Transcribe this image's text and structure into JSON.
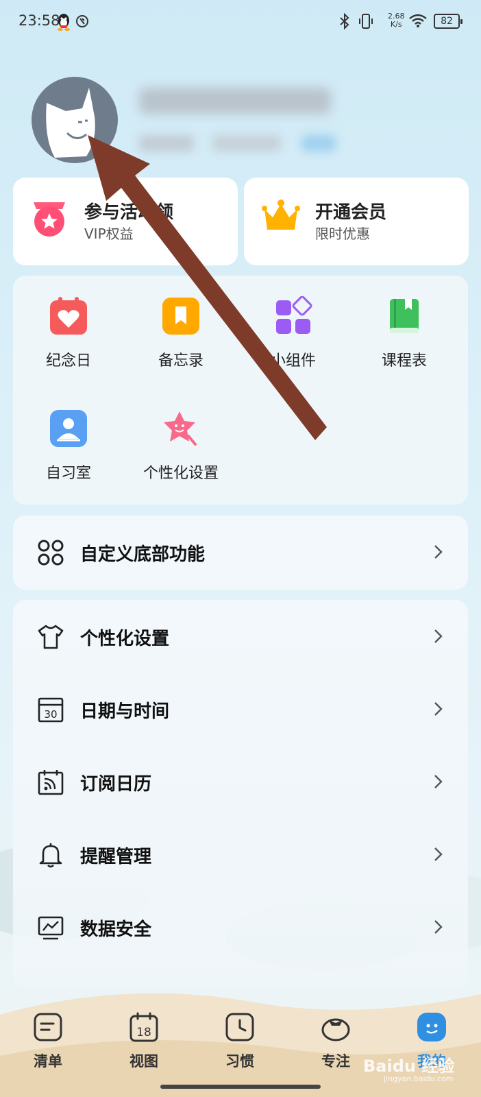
{
  "status_bar": {
    "time": "23:58",
    "net_speed_value": "2.68",
    "net_speed_unit": "K/s",
    "battery": "82"
  },
  "promo": {
    "activity": {
      "title": "参与活动领",
      "subtitle": "VIP权益",
      "icon": "medal-star-icon"
    },
    "membership": {
      "title": "开通会员",
      "subtitle": "限时优惠",
      "icon": "crown-icon"
    }
  },
  "tools": [
    {
      "label": "纪念日",
      "icon": "anniversary-heart-icon"
    },
    {
      "label": "备忘录",
      "icon": "memo-bookmark-icon"
    },
    {
      "label": "小组件",
      "icon": "widgets-icon"
    },
    {
      "label": "课程表",
      "icon": "schedule-book-icon"
    },
    {
      "label": "自习室",
      "icon": "study-room-icon"
    },
    {
      "label": "个性化设置",
      "icon": "star-personalize-icon"
    }
  ],
  "custom_bottom": {
    "label": "自定义底部功能",
    "icon": "grid-circles-icon"
  },
  "settings": [
    {
      "label": "个性化设置",
      "icon": "shirt-icon"
    },
    {
      "label": "日期与时间",
      "icon": "calendar-30-icon"
    },
    {
      "label": "订阅日历",
      "icon": "calendar-rss-icon"
    },
    {
      "label": "提醒管理",
      "icon": "bell-icon"
    },
    {
      "label": "数据安全",
      "icon": "chart-monitor-icon"
    }
  ],
  "tabbar": [
    {
      "label": "清单",
      "icon": "list-icon"
    },
    {
      "label": "视图",
      "icon": "calendar-18-icon",
      "icon_text": "18"
    },
    {
      "label": "习惯",
      "icon": "clock-icon"
    },
    {
      "label": "专注",
      "icon": "tomato-icon"
    },
    {
      "label": "我的",
      "icon": "profile-face-icon",
      "active": true
    }
  ],
  "watermark": {
    "main": "Baidu 经验",
    "sub": "jingyan.baidu.com"
  },
  "colors": {
    "accent": "#2f8fe0",
    "arrow": "#7e3b2a",
    "background": "#d6eef8"
  }
}
